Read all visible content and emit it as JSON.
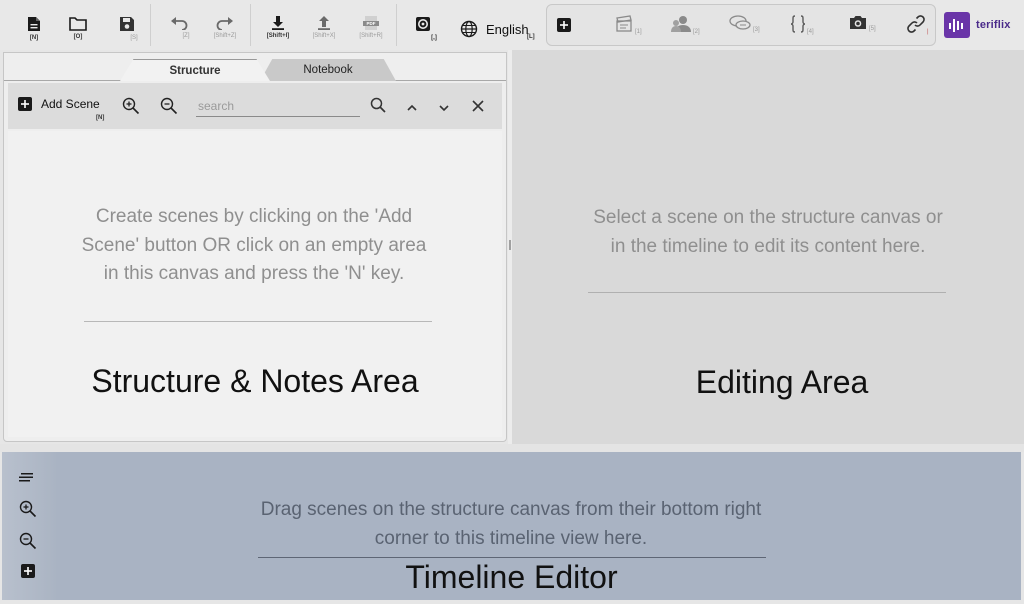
{
  "toolbar": {
    "new_sc": "[N]",
    "open_sc": "[O]",
    "save_sc": "[S]",
    "undo_sc": "[Z]",
    "redo_sc": "[Shift+Z]",
    "import_sc": "[Shift+I]",
    "export_sc": "[Shift+X]",
    "pdf_sc": "[Shift+R]",
    "settings_sc": "[,]",
    "language_label": "English",
    "language_sc": "[L]",
    "pdf_badge": "PDF"
  },
  "elements": [
    {
      "icon": "clapperboard-icon",
      "sc": "[1]"
    },
    {
      "icon": "characters-icon",
      "sc": "[2]"
    },
    {
      "icon": "dialogue-icon",
      "sc": "[3]"
    },
    {
      "icon": "braces-icon",
      "sc": "[4]"
    },
    {
      "icon": "camera-icon",
      "sc": "[5]"
    },
    {
      "icon": "link-icon",
      "sc": "|"
    }
  ],
  "brand": {
    "name": "teriflix",
    "color": "#6a35a8"
  },
  "structure": {
    "tabs": [
      "Structure",
      "Notebook"
    ],
    "add_scene_label": "Add Scene",
    "add_scene_sc": "[N]",
    "search_placeholder": "search",
    "hint": "Create scenes by clicking on the 'Add Scene' button OR click on an empty area in this canvas and press the 'N' key.",
    "caption": "Structure & Notes Area"
  },
  "editing": {
    "hint": "Select a scene on the structure canvas or in the timeline to edit its content here.",
    "caption": "Editing Area"
  },
  "timeline": {
    "hint": "Drag scenes on the structure canvas from their bottom right corner to this timeline view here.",
    "caption": "Timeline Editor"
  },
  "colors": {
    "timeline_bg": "#a9b3c3",
    "editing_bg": "#d9d9d9",
    "structure_bg": "#f1f1f1"
  }
}
